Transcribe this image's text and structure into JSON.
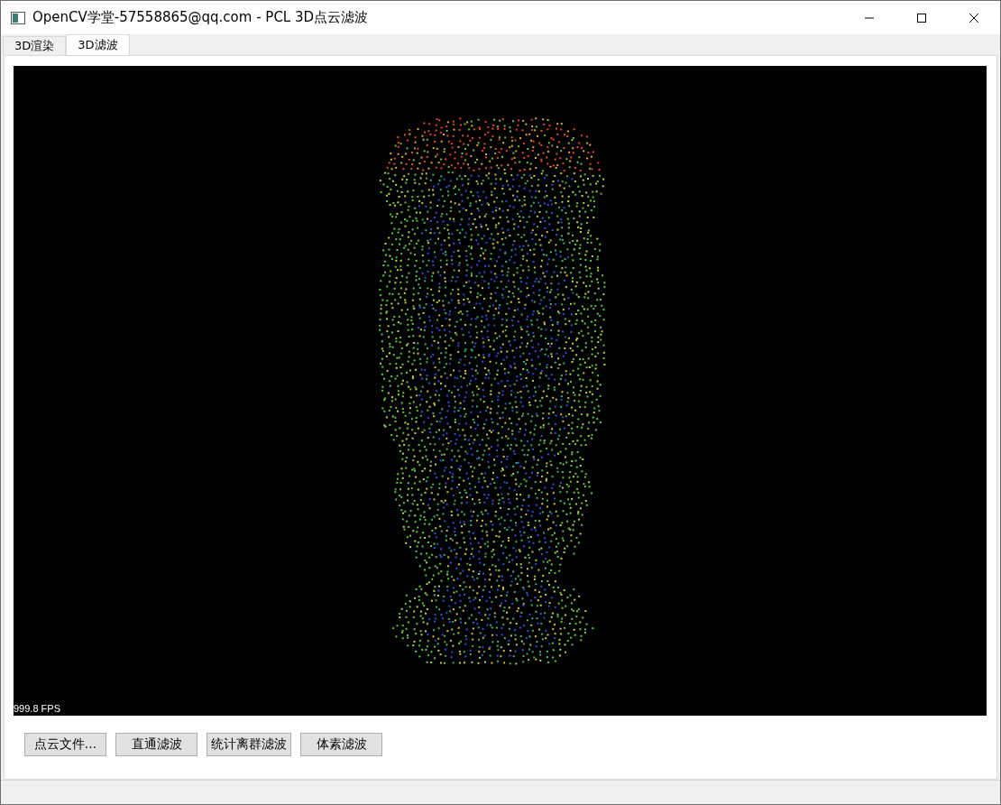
{
  "window": {
    "title": "OpenCV学堂-57558865@qq.com - PCL 3D点云滤波"
  },
  "tabs": [
    {
      "label": "3D渲染",
      "selected": false
    },
    {
      "label": "3D滤波",
      "selected": true
    }
  ],
  "viewer": {
    "fps": "999.8 FPS"
  },
  "buttons": [
    "点云文件...",
    "直通滤波",
    "统计离群滤波",
    "体素滤波"
  ]
}
